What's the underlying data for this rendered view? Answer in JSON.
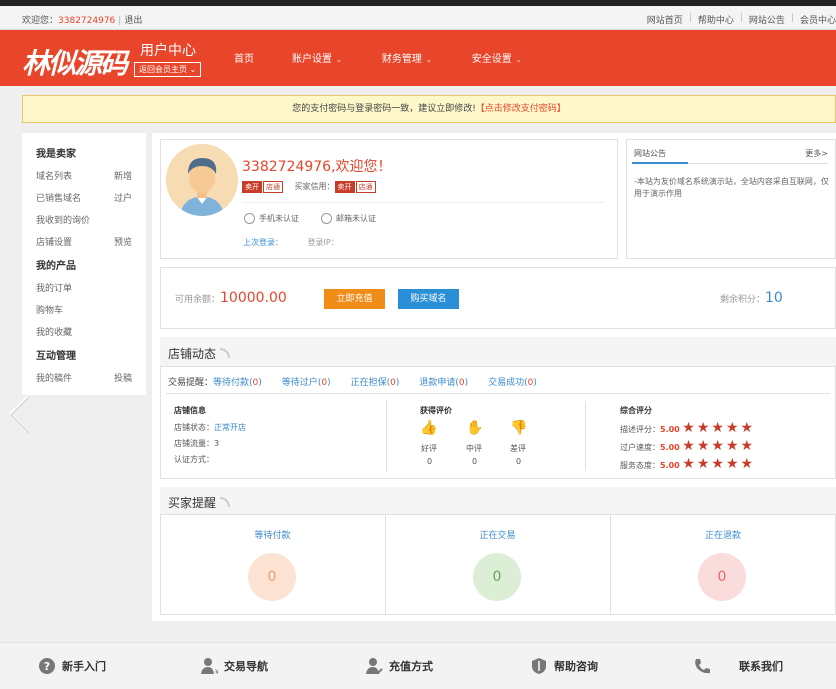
{
  "topbar": {
    "welcome": "欢迎您：",
    "phone": "3382724976",
    "sep": "|",
    "logout": "退出",
    "links": [
      "网站首页",
      "帮助中心",
      "网站公告",
      "会员中心"
    ]
  },
  "header": {
    "logo": "林似源码",
    "user_center": "用户中心",
    "back_select": "返回会员主页",
    "nav": [
      {
        "label": "首页",
        "caret": ""
      },
      {
        "label": "账户设置",
        "caret": "⌄"
      },
      {
        "label": "财务管理",
        "caret": "⌄"
      },
      {
        "label": "安全设置",
        "caret": "⌄"
      }
    ]
  },
  "notice": {
    "text": "您的支付密码与登录密码一致，建议立即修改!",
    "link": "【点击修改支付密码】"
  },
  "sidebar": {
    "seller_title": "我是卖家",
    "seller_items": [
      {
        "label": "域名列表",
        "action": "新增"
      },
      {
        "label": "已销售域名",
        "action": "过户"
      },
      {
        "label": "我收到的询价",
        "action": ""
      },
      {
        "label": "店铺设置",
        "action": "预览"
      }
    ],
    "product_title": "我的产品",
    "product_items": [
      "我的订单",
      "购物车",
      "我的收藏"
    ],
    "interact_title": "互动管理",
    "interact_items": [
      {
        "label": "我的稿件",
        "action": "投稿"
      }
    ]
  },
  "profile": {
    "greeting": "3382724976,欢迎您！",
    "seller_tag_a": "卖开",
    "seller_tag_b": "店通",
    "buyer_credit_label": "买家信用：",
    "buyer_tag_a": "卖开",
    "buyer_tag_b": "店通",
    "phone_status": "手机未认证",
    "email_status": "邮箱未认证",
    "last_login": "上次登录：",
    "login_ip": "登录IP："
  },
  "announcement": {
    "title": "网站公告",
    "more": "更多>",
    "content": "-本站为友价域名系统演示站，全站内容采自互联网，仅用于演示作用"
  },
  "balance": {
    "label": "可用余额：",
    "value": "10000.00",
    "recharge_button": "立即充值",
    "buy_button": "购买域名",
    "points_label": "剩余积分：",
    "points_value": "10"
  },
  "shop_dynamics": {
    "title": "店铺动态",
    "tips_label": "交易提醒：",
    "tips": [
      {
        "label": "等待付款",
        "count": "0"
      },
      {
        "label": "等待过户",
        "count": "0"
      },
      {
        "label": "正在担保",
        "count": "0"
      },
      {
        "label": "退款申请",
        "count": "0"
      },
      {
        "label": "交易成功",
        "count": "0"
      }
    ],
    "shop_info_title": "店铺信息",
    "shop_status_label": "店铺状态：",
    "shop_status": "正常开店",
    "shop_traffic_label": "店铺流量：",
    "shop_traffic": "3",
    "cert_label": "认证方式：",
    "rating_title": "获得评价",
    "ratings": [
      {
        "label": "好评",
        "count": "0"
      },
      {
        "label": "中评",
        "count": "0"
      },
      {
        "label": "差评",
        "count": "0"
      }
    ],
    "score_title": "综合评分",
    "scores": [
      {
        "label": "描述评分：",
        "value": "5.00"
      },
      {
        "label": "过户速度：",
        "value": "5.00"
      },
      {
        "label": "服务态度：",
        "value": "5.00"
      }
    ]
  },
  "buyer_remind": {
    "title": "买家提醒",
    "items": [
      {
        "label": "等待付款",
        "count": "0",
        "bg": "#fde3d3",
        "fg": "#e8a06a"
      },
      {
        "label": "正在交易",
        "count": "0",
        "bg": "#dcefd6",
        "fg": "#5ea85a"
      },
      {
        "label": "正在退款",
        "count": "0",
        "bg": "#fbdcdc",
        "fg": "#e06a6a"
      }
    ]
  },
  "footer": {
    "items": [
      "新手入门",
      "交易导航",
      "充值方式",
      "帮助咨询",
      "联系我们"
    ]
  },
  "colors": {
    "brand": "#e8452a",
    "link": "#3b8bd0",
    "orange_button": "#f08c18",
    "blue_button": "#2a8fd6"
  }
}
